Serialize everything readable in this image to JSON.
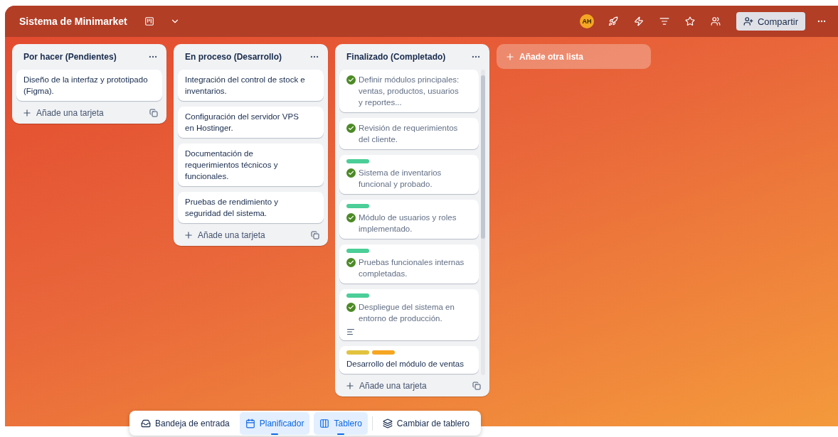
{
  "board": {
    "title": "Sistema de Minimarket",
    "avatar": "AH",
    "share_label": "Compartir"
  },
  "lists": [
    {
      "title": "Por hacer (Pendientes)",
      "add_label": "Añade una tarjeta",
      "cards": [
        {
          "text": "Diseño de la interfaz y prototipado (Figma)."
        }
      ]
    },
    {
      "title": "En proceso (Desarrollo)",
      "add_label": "Añade una tarjeta",
      "cards": [
        {
          "text": "Integración del control de stock e inventarios."
        },
        {
          "text": "Configuración del servidor VPS en Hostinger."
        },
        {
          "text": "Documentación de requerimientos técnicos y funcionales."
        },
        {
          "text": "Pruebas de rendimiento y seguridad del sistema."
        }
      ]
    },
    {
      "title": "Finalizado (Completado)",
      "add_label": "Añade una tarjeta",
      "cards": [
        {
          "text": "Definir módulos principales: ventas, productos, usuarios y reportes...",
          "done": true
        },
        {
          "text": "Revisión de requerimientos del cliente.",
          "done": true
        },
        {
          "text": "Sistema de inventarios funcional y probado.",
          "done": true,
          "labels": [
            {
              "color": "#4bce97"
            }
          ]
        },
        {
          "text": "Módulo de usuarios y roles implementado.",
          "done": true,
          "labels": [
            {
              "color": "#4bce97"
            }
          ]
        },
        {
          "text": "Pruebas funcionales internas completadas.",
          "done": true,
          "labels": [
            {
              "color": "#4bce97"
            }
          ]
        },
        {
          "text": "Despliegue del sistema en entorno de producción.",
          "done": true,
          "description": true,
          "labels": [
            {
              "color": "#4bce97"
            }
          ]
        },
        {
          "text": "Desarrollo del módulo de ventas",
          "labels": [
            {
              "color": "#e2c33f"
            },
            {
              "color": "#f5a623"
            }
          ]
        }
      ]
    }
  ],
  "add_list_label": "Añade otra lista",
  "bottom_nav": [
    {
      "kind": "inbox",
      "label": "Bandeja de entrada",
      "selected": false
    },
    {
      "kind": "planner",
      "label": "Planificador",
      "selected": true
    },
    {
      "kind": "board",
      "label": "Tablero",
      "selected": true
    },
    {
      "kind": "switch",
      "label": "Cambiar de tablero",
      "selected": false
    }
  ]
}
